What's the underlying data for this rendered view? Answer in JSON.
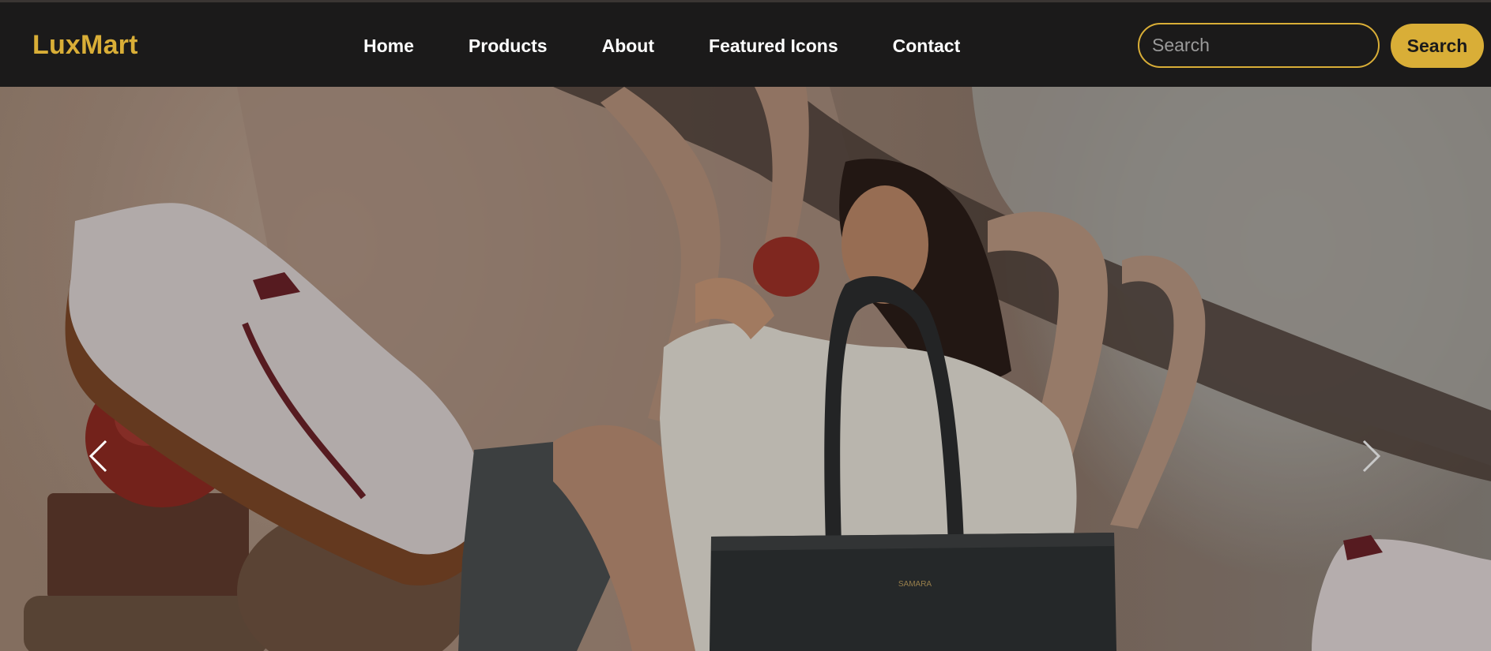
{
  "brand": {
    "name": "LuxMart"
  },
  "nav": {
    "items": [
      {
        "label": "Home"
      },
      {
        "label": "Products"
      },
      {
        "label": "About"
      },
      {
        "label": "Featured Icons"
      },
      {
        "label": "Contact"
      }
    ]
  },
  "search": {
    "placeholder": "Search",
    "value": "",
    "button_label": "Search"
  },
  "hero": {
    "prev_icon": "chevron-left-icon",
    "next_icon": "chevron-right-icon",
    "tote_brand": "SAMARA"
  },
  "colors": {
    "accent": "#d9ae37",
    "navbar_bg": "#1b1a1a",
    "nav_text": "#ffffff"
  }
}
